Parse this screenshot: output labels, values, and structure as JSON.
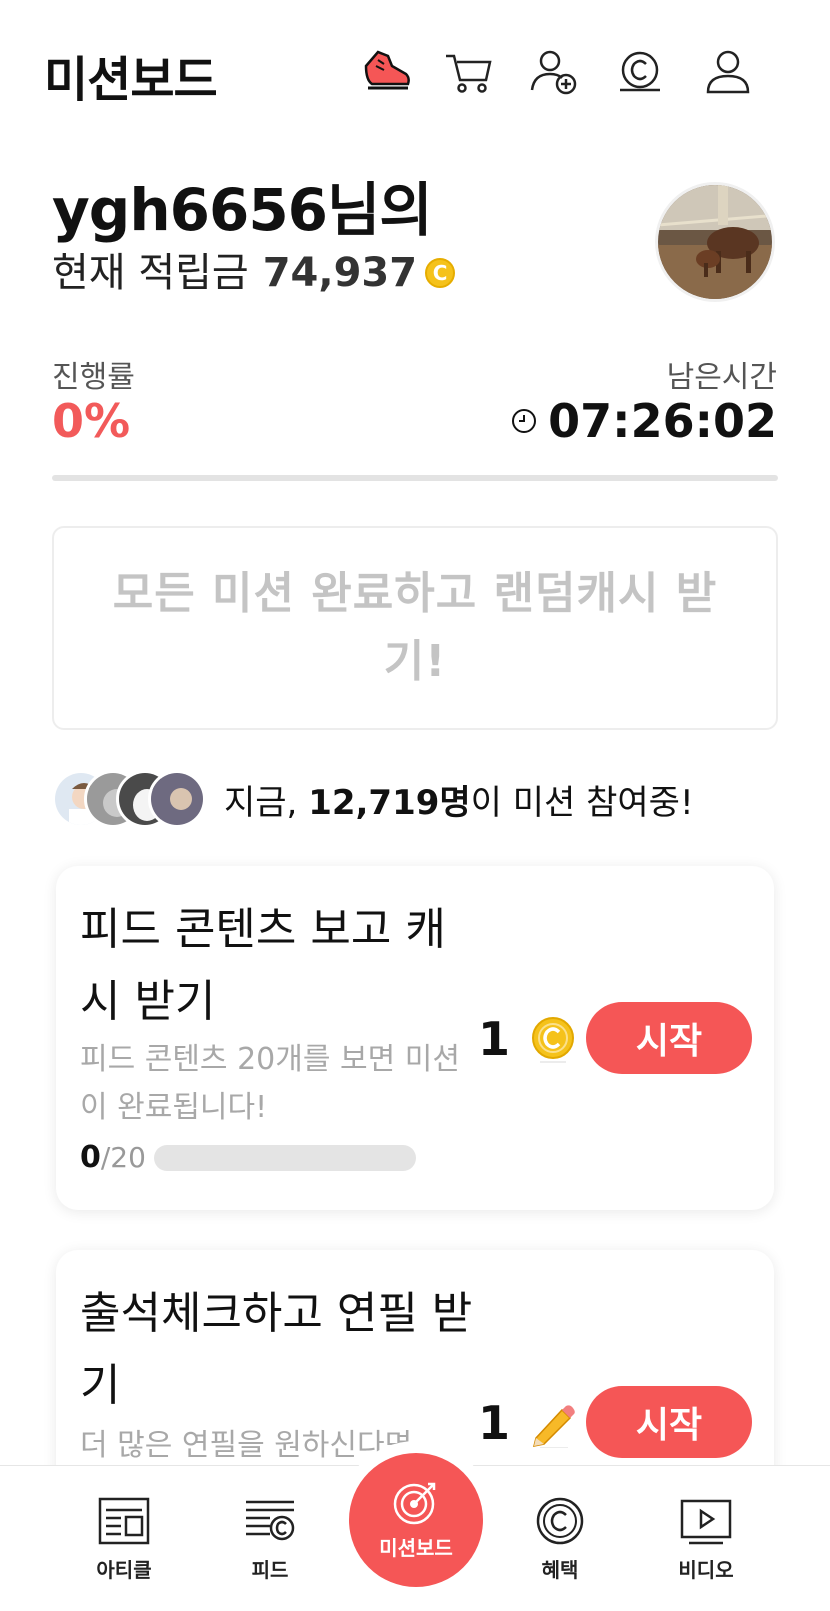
{
  "header": {
    "title": "미션보드",
    "icons": [
      "shoe-icon",
      "cart-icon",
      "add-friend-icon",
      "coin-icon",
      "user-icon"
    ]
  },
  "profile": {
    "greeting": "ygh6656님의",
    "balance_label": "현재 적립금",
    "balance_value": "74,937",
    "coin_symbol": "C"
  },
  "progress": {
    "label": "진행률",
    "value": "0%",
    "fraction": 0,
    "remaining_label": "남은시간",
    "remaining_value": "07:26:02"
  },
  "bonus": {
    "text": "모든 미션 완료하고 랜덤캐시 받기!"
  },
  "participants": {
    "prefix": "지금, ",
    "count": "12,719명",
    "suffix": "이 미션 참여중!"
  },
  "missions": [
    {
      "title": "피드 콘텐츠 보고 캐시 받기",
      "description": "피드 콘텐츠 20개를 보면 미션이 완료됩니다!",
      "progress_current": "0",
      "progress_total": "/20",
      "reward": "1",
      "reward_icon": "coin-icon",
      "button": "시작"
    },
    {
      "title": "출석체크하고 연필 받기",
      "description": "더 많은 연필을 원하신다면",
      "reward": "1",
      "reward_icon": "pencil-icon",
      "button": "시작"
    }
  ],
  "tabbar": {
    "items": [
      {
        "label": "아티클",
        "icon": "article-icon"
      },
      {
        "label": "피드",
        "icon": "feed-icon"
      },
      {
        "label": "미션보드",
        "icon": "target-icon"
      },
      {
        "label": "혜택",
        "icon": "benefit-coin-icon"
      },
      {
        "label": "비디오",
        "icon": "video-icon"
      }
    ]
  },
  "colors": {
    "accent": "#f55656",
    "coin": "#f5c21b",
    "muted": "#c4c4c4"
  }
}
